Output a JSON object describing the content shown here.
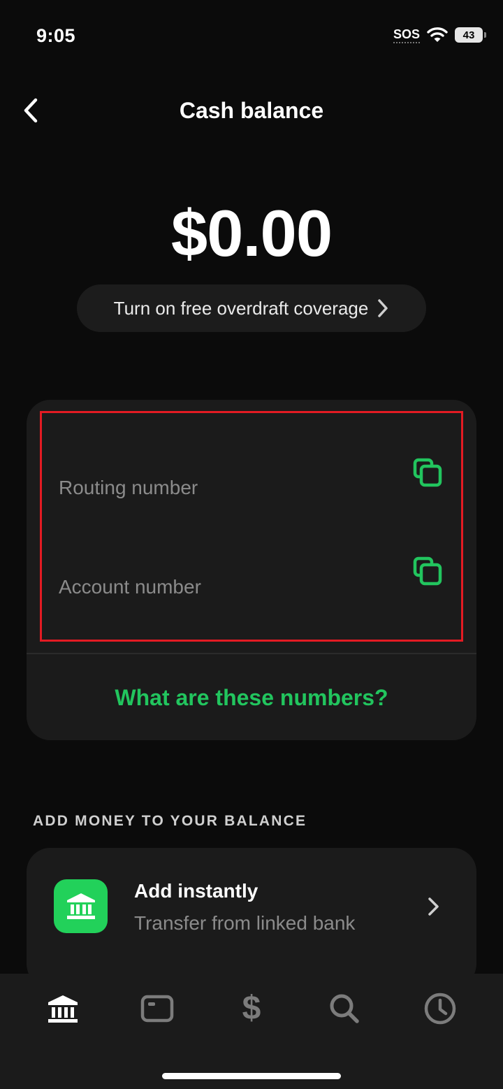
{
  "status_bar": {
    "time": "9:05",
    "sos": "SOS",
    "battery": "43"
  },
  "header": {
    "title": "Cash balance"
  },
  "balance": {
    "amount": "$0.00"
  },
  "overdraft": {
    "label": "Turn on free overdraft coverage"
  },
  "account_card": {
    "routing_label": "Routing number",
    "account_label": "Account number",
    "info_link": "What are these numbers?",
    "accent_color": "#22c55e",
    "highlight_color": "#e31b23"
  },
  "add_money": {
    "section_title": "ADD MONEY TO YOUR BALANCE",
    "items": [
      {
        "title": "Add instantly",
        "subtitle": "Transfer from linked bank",
        "icon": "bank-icon"
      }
    ]
  },
  "tab_bar": {
    "tabs": [
      {
        "name": "home",
        "icon": "bank-icon",
        "active": true
      },
      {
        "name": "card",
        "icon": "card-icon",
        "active": false
      },
      {
        "name": "pay",
        "icon": "dollar-icon",
        "active": false
      },
      {
        "name": "search",
        "icon": "search-icon",
        "active": false
      },
      {
        "name": "activity",
        "icon": "clock-icon",
        "active": false
      }
    ]
  }
}
